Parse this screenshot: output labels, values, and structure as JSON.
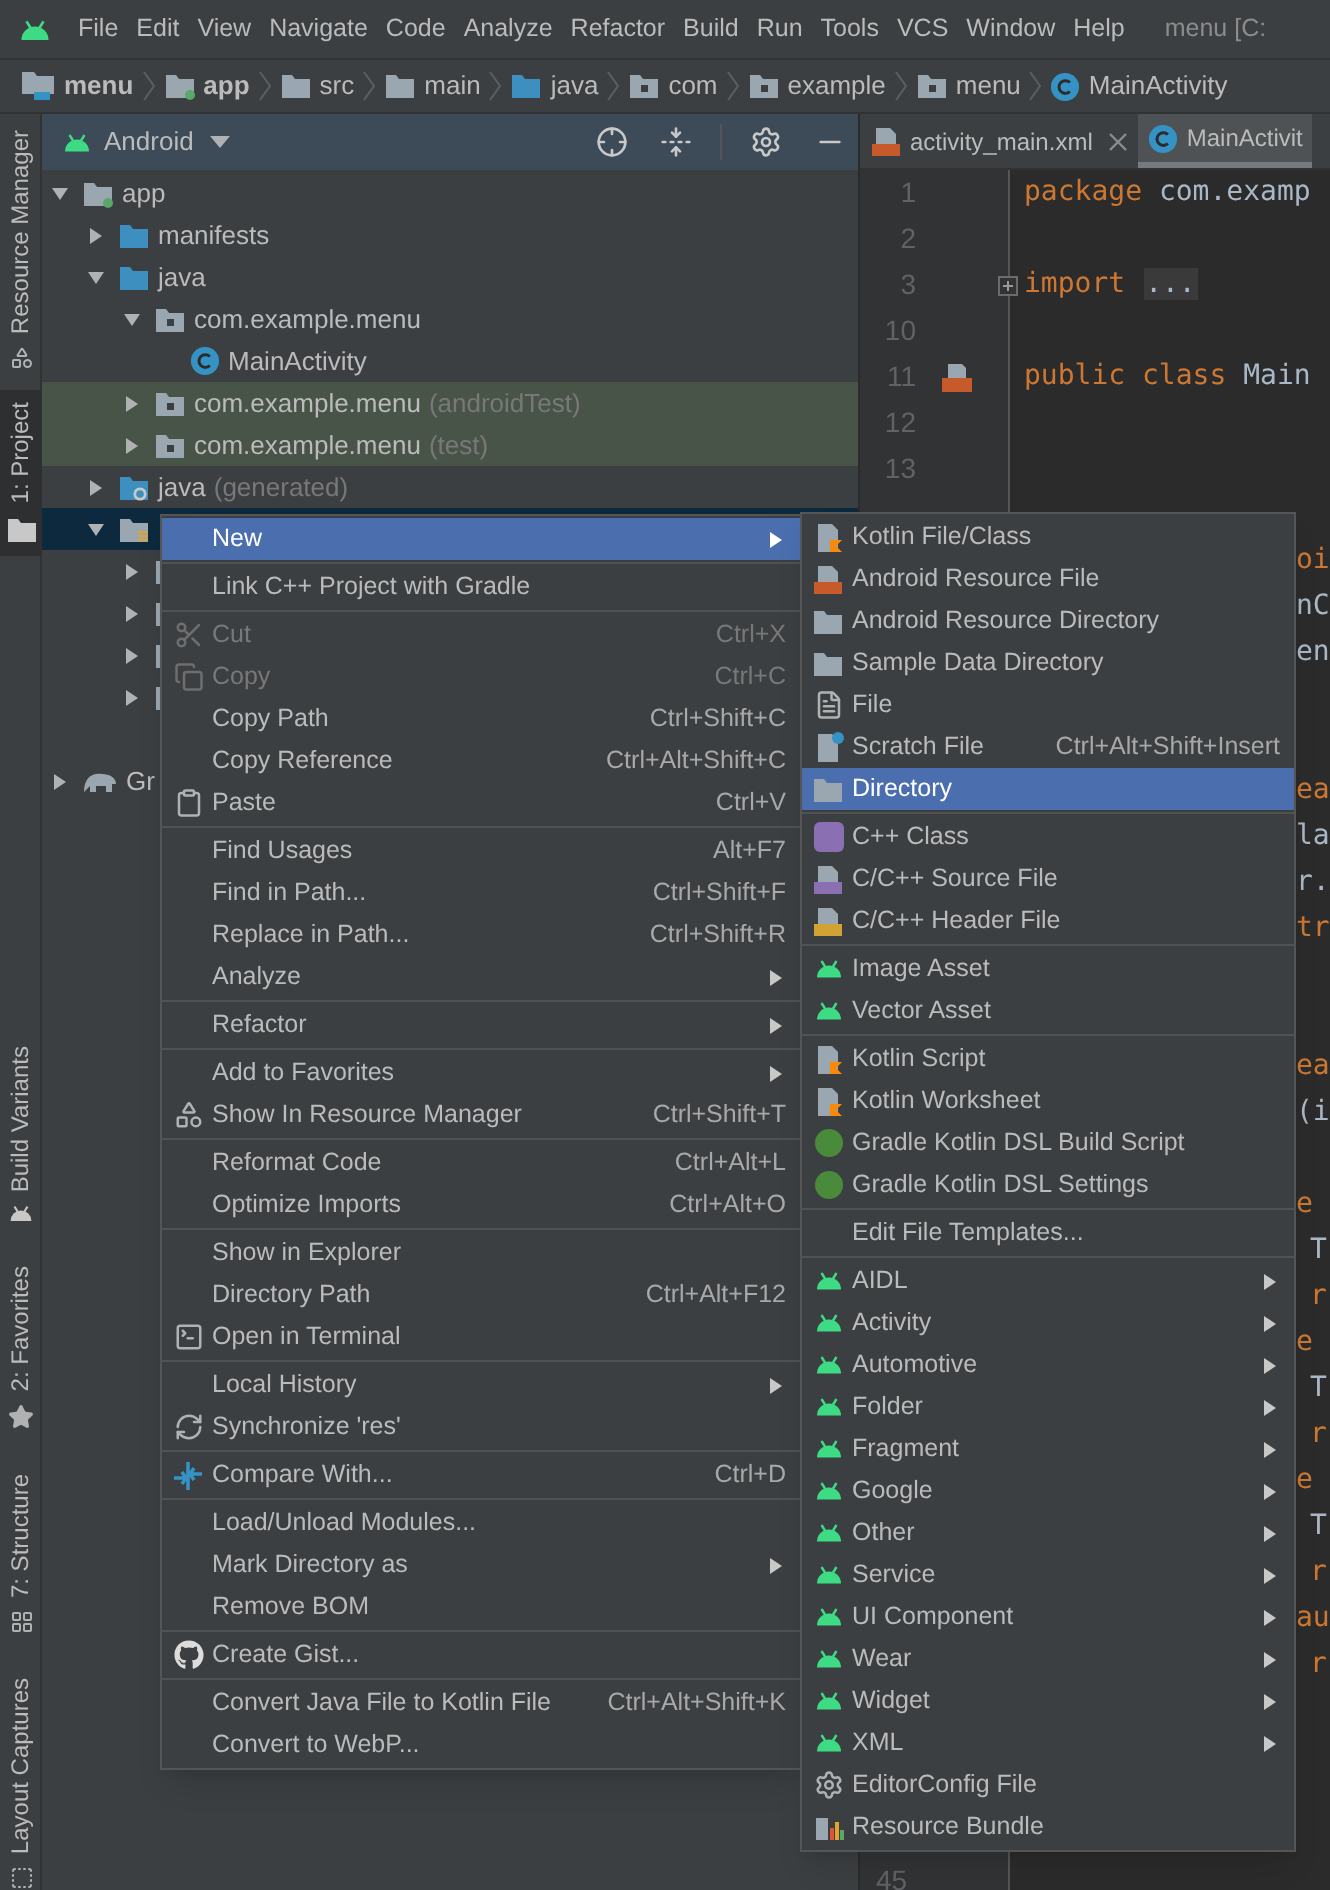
{
  "menu_bar": {
    "items": [
      "File",
      "Edit",
      "View",
      "Navigate",
      "Code",
      "Analyze",
      "Refactor",
      "Build",
      "Run",
      "Tools",
      "VCS",
      "Window",
      "Help"
    ],
    "project_title": "menu [C:"
  },
  "breadcrumbs": [
    {
      "label": "menu",
      "kind": "project",
      "bold": true
    },
    {
      "label": "app",
      "kind": "module",
      "bold": true
    },
    {
      "label": "src",
      "kind": "folder",
      "bold": false
    },
    {
      "label": "main",
      "kind": "folder",
      "bold": false
    },
    {
      "label": "java",
      "kind": "sources",
      "bold": false
    },
    {
      "label": "com",
      "kind": "package",
      "bold": false
    },
    {
      "label": "example",
      "kind": "package",
      "bold": false
    },
    {
      "label": "menu",
      "kind": "package",
      "bold": false
    },
    {
      "label": "MainActivity",
      "kind": "class",
      "bold": false
    }
  ],
  "tool_strip": [
    {
      "label": "Resource Manager",
      "kind": "resources",
      "selected": false
    },
    {
      "label": "1: Project",
      "kind": "folder",
      "selected": true
    },
    {
      "label": "Build Variants",
      "kind": "android",
      "selected": false
    },
    {
      "label": "2: Favorites",
      "kind": "star",
      "selected": false
    },
    {
      "label": "7: Structure",
      "kind": "structure",
      "selected": false
    },
    {
      "label": "Layout Captures",
      "kind": "captures",
      "selected": false
    }
  ],
  "project_panel": {
    "title": "Android",
    "tree": [
      {
        "label": "app",
        "kind": "module",
        "expanded": true,
        "selected": false,
        "children": [
          {
            "label": "manifests",
            "kind": "folder",
            "expanded": false,
            "selected": false
          },
          {
            "label": "java",
            "kind": "folder",
            "expanded": true,
            "selected": false,
            "children": [
              {
                "label": "com.example.menu",
                "kind": "package",
                "expanded": true,
                "selected": false,
                "children": [
                  {
                    "label": "MainActivity",
                    "kind": "class",
                    "selected": false
                  }
                ]
              },
              {
                "label": "com.example.menu",
                "suffix": "(androidTest)",
                "kind": "test",
                "expanded": false,
                "selected": false
              },
              {
                "label": "com.example.menu",
                "suffix": "(test)",
                "kind": "test",
                "expanded": false,
                "selected": false
              }
            ]
          },
          {
            "label": "java",
            "suffix": "(generated)",
            "kind": "generated",
            "expanded": false,
            "selected": false
          },
          {
            "kind": "resources",
            "expanded": true,
            "selected": true,
            "children": [
              {
                "kind": "folder-grey",
                "expanded": false
              },
              {
                "kind": "folder-grey",
                "expanded": false
              },
              {
                "kind": "folder-grey",
                "expanded": false
              },
              {
                "kind": "folder-grey",
                "expanded": false
              }
            ]
          }
        ]
      },
      {
        "label": "Gr",
        "kind": "gradle",
        "expanded": false,
        "selected": false
      }
    ]
  },
  "editor": {
    "tabs": [
      {
        "label": "activity_main.xml",
        "kind": "xml",
        "selected": false,
        "closable": true
      },
      {
        "label": "MainActivit",
        "kind": "class",
        "selected": true,
        "closable": false
      }
    ],
    "lines": [
      {
        "number": "1",
        "kind": "code",
        "tokens": [
          {
            "text": "package",
            "kind": "keyword"
          },
          {
            "text": " com.examp",
            "kind": "plain"
          }
        ]
      },
      {
        "number": "2",
        "kind": "blank"
      },
      {
        "number": "3",
        "kind": "fold",
        "tokens": [
          {
            "text": "import",
            "kind": "keyword"
          },
          {
            "text": "...",
            "kind": "folded"
          }
        ]
      },
      {
        "number": "10",
        "kind": "blank"
      },
      {
        "number": "11",
        "kind": "marker",
        "tokens": [
          {
            "text": "public class",
            "kind": "keyword"
          },
          {
            "text": " Main",
            "kind": "plain"
          }
        ]
      },
      {
        "number": "12",
        "kind": "blank"
      },
      {
        "number": "13",
        "kind": "blank"
      },
      {
        "kind": "blank"
      },
      {
        "kind": "tail",
        "tokens": [
          {
            "text": "oi",
            "kind": "keyword"
          }
        ]
      },
      {
        "kind": "tail",
        "tokens": [
          {
            "text": "nC",
            "kind": "plain"
          }
        ]
      },
      {
        "kind": "tail",
        "tokens": [
          {
            "text": "en",
            "kind": "plain"
          }
        ]
      },
      {
        "kind": "blank"
      },
      {
        "kind": "blank"
      },
      {
        "kind": "tail",
        "tokens": [
          {
            "text": "ea",
            "kind": "keyword"
          }
        ]
      },
      {
        "kind": "tail",
        "tokens": [
          {
            "text": "la",
            "kind": "plain"
          }
        ]
      },
      {
        "kind": "tail",
        "tokens": [
          {
            "text": "r.",
            "kind": "plain"
          }
        ]
      },
      {
        "kind": "tail",
        "tokens": [
          {
            "text": "tr",
            "kind": "keyword"
          }
        ]
      },
      {
        "kind": "blank"
      },
      {
        "kind": "blank"
      },
      {
        "kind": "tail",
        "tokens": [
          {
            "text": "ea",
            "kind": "keyword"
          }
        ]
      },
      {
        "kind": "tail",
        "tokens": [
          {
            "text": "(i",
            "kind": "plain"
          }
        ]
      },
      {
        "kind": "blank"
      },
      {
        "kind": "tail",
        "tokens": [
          {
            "text": "e",
            "kind": "keyword"
          }
        ]
      },
      {
        "kind": "tail-indented",
        "tokens": [
          {
            "text": "T",
            "kind": "plain"
          }
        ]
      },
      {
        "kind": "tail-indented",
        "tokens": [
          {
            "text": "r",
            "kind": "keyword"
          }
        ]
      },
      {
        "kind": "tail",
        "tokens": [
          {
            "text": "e",
            "kind": "keyword"
          }
        ]
      },
      {
        "kind": "tail-indented",
        "tokens": [
          {
            "text": "T",
            "kind": "plain"
          }
        ]
      },
      {
        "kind": "tail-indented",
        "tokens": [
          {
            "text": "r",
            "kind": "keyword"
          }
        ]
      },
      {
        "kind": "tail",
        "tokens": [
          {
            "text": "e",
            "kind": "keyword"
          }
        ]
      },
      {
        "kind": "tail-indented",
        "tokens": [
          {
            "text": "T",
            "kind": "plain"
          }
        ]
      },
      {
        "kind": "tail-indented",
        "tokens": [
          {
            "text": "r",
            "kind": "keyword"
          }
        ]
      },
      {
        "kind": "tail",
        "tokens": [
          {
            "text": "au",
            "kind": "keyword"
          }
        ]
      },
      {
        "kind": "tail-indented",
        "tokens": [
          {
            "text": "r",
            "kind": "keyword"
          }
        ]
      }
    ],
    "bottom_line_number": "45"
  },
  "context_menu": {
    "groups": [
      [
        {
          "label": "New",
          "kind": "plain",
          "submenu": true,
          "disabled": false,
          "selected": true
        }
      ],
      [
        {
          "label": "Link C++ Project with Gradle",
          "kind": "plain",
          "submenu": false,
          "disabled": false,
          "selected": false
        }
      ],
      [
        {
          "label": "Cut",
          "shortcut": "Ctrl+X",
          "kind": "cut",
          "submenu": false,
          "disabled": true,
          "selected": false
        },
        {
          "label": "Copy",
          "shortcut": "Ctrl+C",
          "kind": "copy",
          "submenu": false,
          "disabled": true,
          "selected": false
        },
        {
          "label": "Copy Path",
          "shortcut": "Ctrl+Shift+C",
          "kind": "plain",
          "submenu": false,
          "disabled": false,
          "selected": false
        },
        {
          "label": "Copy Reference",
          "shortcut": "Ctrl+Alt+Shift+C",
          "kind": "plain",
          "submenu": false,
          "disabled": false,
          "selected": false
        },
        {
          "label": "Paste",
          "shortcut": "Ctrl+V",
          "kind": "paste",
          "submenu": false,
          "disabled": false,
          "selected": false
        }
      ],
      [
        {
          "label": "Find Usages",
          "shortcut": "Alt+F7",
          "kind": "plain",
          "submenu": false,
          "disabled": false,
          "selected": false
        },
        {
          "label": "Find in Path...",
          "shortcut": "Ctrl+Shift+F",
          "kind": "plain",
          "submenu": false,
          "disabled": false,
          "selected": false
        },
        {
          "label": "Replace in Path...",
          "shortcut": "Ctrl+Shift+R",
          "kind": "plain",
          "submenu": false,
          "disabled": false,
          "selected": false
        },
        {
          "label": "Analyze",
          "kind": "plain",
          "submenu": true,
          "disabled": false,
          "selected": false
        }
      ],
      [
        {
          "label": "Refactor",
          "kind": "plain",
          "submenu": true,
          "disabled": false,
          "selected": false
        }
      ],
      [
        {
          "label": "Add to Favorites",
          "kind": "plain",
          "submenu": true,
          "disabled": false,
          "selected": false
        },
        {
          "label": "Show In Resource Manager",
          "shortcut": "Ctrl+Shift+T",
          "kind": "resources",
          "submenu": false,
          "disabled": false,
          "selected": false
        }
      ],
      [
        {
          "label": "Reformat Code",
          "shortcut": "Ctrl+Alt+L",
          "kind": "plain",
          "submenu": false,
          "disabled": false,
          "selected": false
        },
        {
          "label": "Optimize Imports",
          "shortcut": "Ctrl+Alt+O",
          "kind": "plain",
          "submenu": false,
          "disabled": false,
          "selected": false
        }
      ],
      [
        {
          "label": "Show in Explorer",
          "kind": "plain",
          "submenu": false,
          "disabled": false,
          "selected": false
        },
        {
          "label": "Directory Path",
          "shortcut": "Ctrl+Alt+F12",
          "kind": "plain",
          "submenu": false,
          "disabled": false,
          "selected": false
        },
        {
          "label": "Open in Terminal",
          "kind": "terminal",
          "submenu": false,
          "disabled": false,
          "selected": false
        }
      ],
      [
        {
          "label": "Local History",
          "kind": "plain",
          "submenu": true,
          "disabled": false,
          "selected": false
        },
        {
          "label": "Synchronize 'res'",
          "kind": "sync",
          "submenu": false,
          "disabled": false,
          "selected": false
        }
      ],
      [
        {
          "label": "Compare With...",
          "shortcut": "Ctrl+D",
          "kind": "compare",
          "submenu": false,
          "disabled": false,
          "selected": false
        }
      ],
      [
        {
          "label": "Load/Unload Modules...",
          "kind": "plain",
          "submenu": false,
          "disabled": false,
          "selected": false
        },
        {
          "label": "Mark Directory as",
          "kind": "plain",
          "submenu": true,
          "disabled": false,
          "selected": false
        },
        {
          "label": "Remove BOM",
          "kind": "plain",
          "submenu": false,
          "disabled": false,
          "selected": false
        }
      ],
      [
        {
          "label": "Create Gist...",
          "kind": "github",
          "submenu": false,
          "disabled": false,
          "selected": false
        }
      ],
      [
        {
          "label": "Convert Java File to Kotlin File",
          "shortcut": "Ctrl+Alt+Shift+K",
          "kind": "plain",
          "submenu": false,
          "disabled": false,
          "selected": false
        },
        {
          "label": "Convert to WebP...",
          "kind": "plain",
          "submenu": false,
          "disabled": false,
          "selected": false
        }
      ]
    ]
  },
  "new_submenu": {
    "groups": [
      [
        {
          "label": "Kotlin File/Class",
          "kind": "kotlin-file",
          "submenu": false,
          "disabled": false,
          "selected": false
        },
        {
          "label": "Android Resource File",
          "kind": "resource-file",
          "submenu": false,
          "disabled": false,
          "selected": false
        },
        {
          "label": "Android Resource Directory",
          "kind": "folder",
          "submenu": false,
          "disabled": false,
          "selected": false
        },
        {
          "label": "Sample Data Directory",
          "kind": "folder",
          "submenu": false,
          "disabled": false,
          "selected": false
        },
        {
          "label": "File",
          "kind": "file",
          "submenu": false,
          "disabled": false,
          "selected": false
        },
        {
          "label": "Scratch File",
          "shortcut": "Ctrl+Alt+Shift+Insert",
          "kind": "scratch",
          "submenu": false,
          "disabled": false,
          "selected": false
        },
        {
          "label": "Directory",
          "kind": "folder",
          "submenu": false,
          "disabled": false,
          "selected": true
        }
      ],
      [
        {
          "label": "C++ Class",
          "kind": "cpp-class",
          "submenu": false,
          "disabled": false,
          "selected": false
        },
        {
          "label": "C/C++ Source File",
          "kind": "cpp-source",
          "submenu": false,
          "disabled": false,
          "selected": false
        },
        {
          "label": "C/C++ Header File",
          "kind": "cpp-header",
          "submenu": false,
          "disabled": false,
          "selected": false
        }
      ],
      [
        {
          "label": "Image Asset",
          "kind": "android",
          "submenu": false,
          "disabled": false,
          "selected": false
        },
        {
          "label": "Vector Asset",
          "kind": "android",
          "submenu": false,
          "disabled": false,
          "selected": false
        }
      ],
      [
        {
          "label": "Kotlin Script",
          "kind": "kotlin-script",
          "submenu": false,
          "disabled": false,
          "selected": false
        },
        {
          "label": "Kotlin Worksheet",
          "kind": "kotlin-script",
          "submenu": false,
          "disabled": false,
          "selected": false
        },
        {
          "label": "Gradle Kotlin DSL Build Script",
          "kind": "gradle",
          "submenu": false,
          "disabled": false,
          "selected": false
        },
        {
          "label": "Gradle Kotlin DSL Settings",
          "kind": "gradle",
          "submenu": false,
          "disabled": false,
          "selected": false
        }
      ],
      [
        {
          "label": "Edit File Templates...",
          "kind": "plain",
          "submenu": false,
          "disabled": false,
          "selected": false
        }
      ],
      [
        {
          "label": "AIDL",
          "kind": "android",
          "submenu": true,
          "disabled": false,
          "selected": false
        },
        {
          "label": "Activity",
          "kind": "android",
          "submenu": true,
          "disabled": false,
          "selected": false
        },
        {
          "label": "Automotive",
          "kind": "android",
          "submenu": true,
          "disabled": false,
          "selected": false
        },
        {
          "label": "Folder",
          "kind": "android",
          "submenu": true,
          "disabled": false,
          "selected": false
        },
        {
          "label": "Fragment",
          "kind": "android",
          "submenu": true,
          "disabled": false,
          "selected": false
        },
        {
          "label": "Google",
          "kind": "android",
          "submenu": true,
          "disabled": false,
          "selected": false
        },
        {
          "label": "Other",
          "kind": "android",
          "submenu": true,
          "disabled": false,
          "selected": false
        },
        {
          "label": "Service",
          "kind": "android",
          "submenu": true,
          "disabled": false,
          "selected": false
        },
        {
          "label": "UI Component",
          "kind": "android",
          "submenu": true,
          "disabled": false,
          "selected": false
        },
        {
          "label": "Wear",
          "kind": "android",
          "submenu": true,
          "disabled": false,
          "selected": false
        },
        {
          "label": "Widget",
          "kind": "android",
          "submenu": true,
          "disabled": false,
          "selected": false
        },
        {
          "label": "XML",
          "kind": "android",
          "submenu": true,
          "disabled": false,
          "selected": false
        },
        {
          "label": "EditorConfig File",
          "kind": "gear",
          "submenu": false,
          "disabled": false,
          "selected": false
        },
        {
          "label": "Resource Bundle",
          "kind": "bundle",
          "submenu": false,
          "disabled": false,
          "selected": false
        }
      ]
    ]
  }
}
